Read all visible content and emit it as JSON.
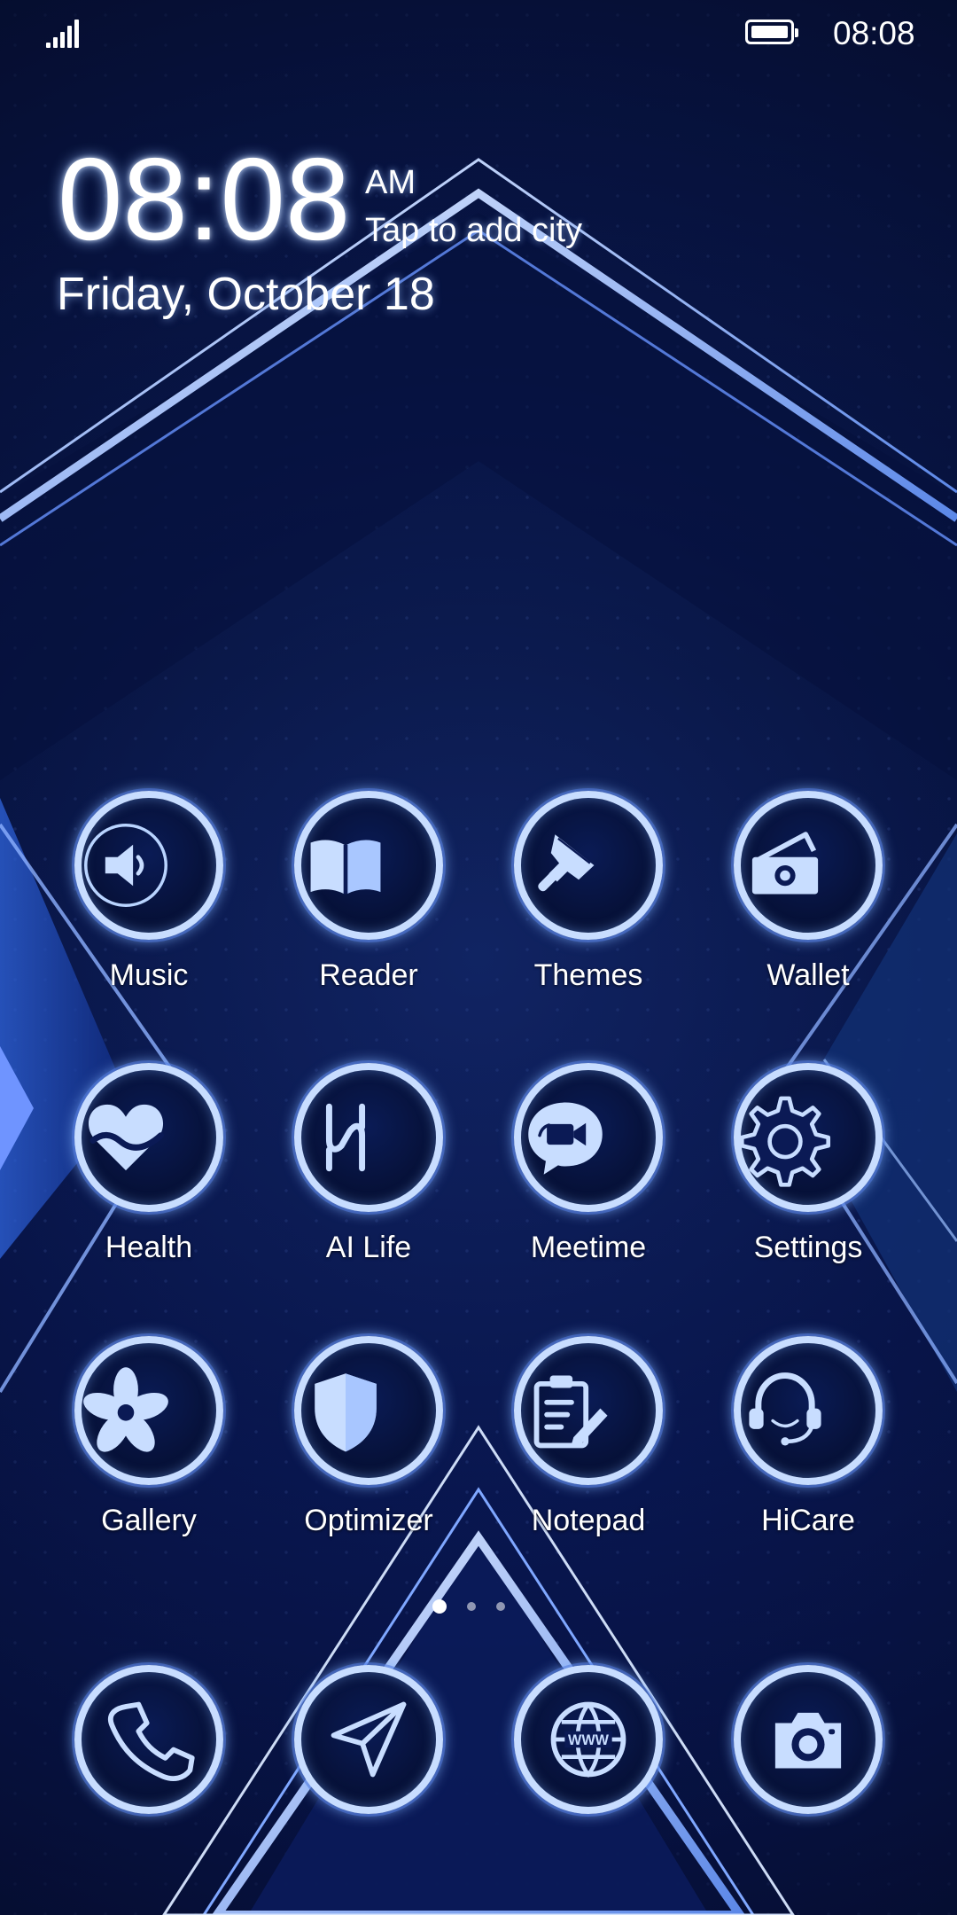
{
  "status_bar": {
    "time": "08:08",
    "signal_icon": "signal-bars-icon",
    "battery_icon": "battery-full-icon"
  },
  "lockscreen": {
    "clock_time": "08:08",
    "ampm": "AM",
    "city_prompt": "Tap to add city",
    "date": "Friday, October 18"
  },
  "apps": [
    {
      "label": "Music",
      "icon": "speaker-icon"
    },
    {
      "label": "Reader",
      "icon": "book-icon"
    },
    {
      "label": "Themes",
      "icon": "brush-icon"
    },
    {
      "label": "Wallet",
      "icon": "wallet-icon"
    },
    {
      "label": "Health",
      "icon": "heart-icon"
    },
    {
      "label": "AI Life",
      "icon": "ai-life-icon"
    },
    {
      "label": "Meetime",
      "icon": "video-chat-icon"
    },
    {
      "label": "Settings",
      "icon": "gear-icon"
    },
    {
      "label": "Gallery",
      "icon": "flower-icon"
    },
    {
      "label": "Optimizer",
      "icon": "shield-icon"
    },
    {
      "label": "Notepad",
      "icon": "notepad-icon"
    },
    {
      "label": "HiCare",
      "icon": "headset-icon"
    }
  ],
  "dock": [
    {
      "icon": "phone-icon"
    },
    {
      "icon": "send-icon"
    },
    {
      "icon": "globe-icon"
    },
    {
      "icon": "camera-icon"
    }
  ],
  "pager": {
    "pages": 3,
    "active_page": 1
  },
  "colors": {
    "background": "#07113d",
    "accent": "#c8ddff",
    "glow": "#82b4ff"
  }
}
